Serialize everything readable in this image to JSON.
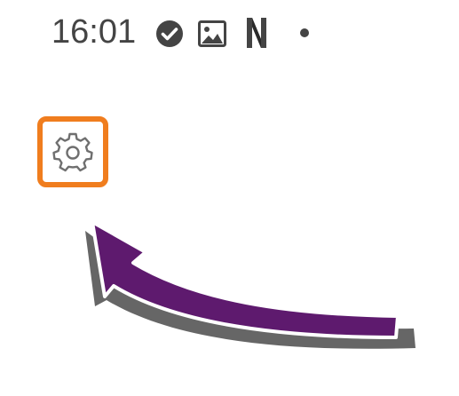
{
  "status_bar": {
    "time": "16:01",
    "icons": [
      "check-circle-icon",
      "image-icon",
      "n-notification-icon",
      "dot-icon"
    ]
  },
  "settings_button": {
    "icon": "gear-icon",
    "highlight_color": "#f07d1e"
  },
  "annotation": {
    "arrow_color": "#5e1a6e",
    "shadow_color": "#666666"
  }
}
